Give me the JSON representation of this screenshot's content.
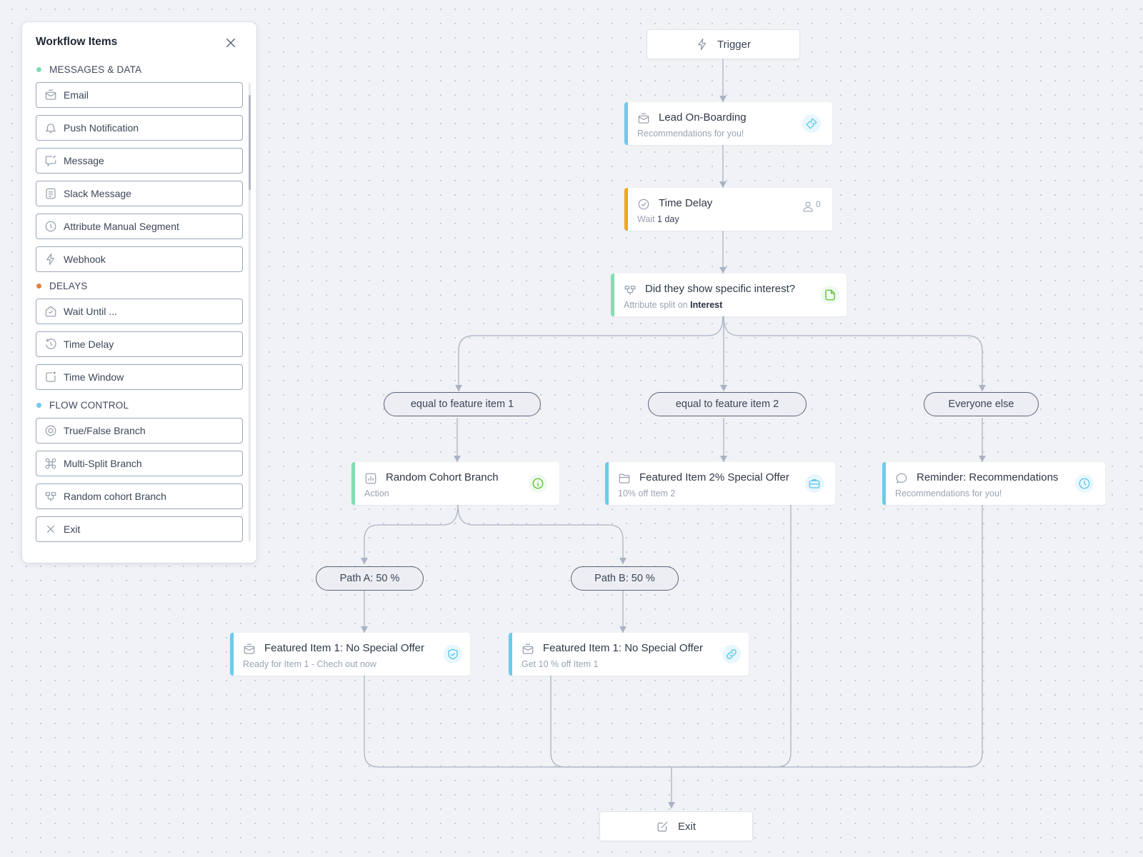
{
  "panel": {
    "title": "Workflow Items",
    "close_icon": "close-icon",
    "sections": [
      {
        "label": "MESSAGES & DATA",
        "dot_color": "#7ee0b0",
        "items": [
          {
            "label": "Email",
            "icon": "envelope-icon"
          },
          {
            "label": "Push Notification",
            "icon": "bell-icon"
          },
          {
            "label": "Message",
            "icon": "chat-bubble-icon"
          },
          {
            "label": "Slack Message",
            "icon": "document-lines-icon"
          },
          {
            "label": "Attribute Manual Segment",
            "icon": "clock-icon"
          },
          {
            "label": "Webhook",
            "icon": "lightning-icon"
          }
        ]
      },
      {
        "label": "DELAYS",
        "dot_color": "#e0803d",
        "items": [
          {
            "label": "Wait Until ...",
            "icon": "open-envelope-check-icon"
          },
          {
            "label": "Time Delay",
            "icon": "history-icon"
          },
          {
            "label": "Time Window",
            "icon": "window-dot-icon"
          }
        ]
      },
      {
        "label": "FLOW CONTROL",
        "dot_color": "#6dcbea",
        "items": [
          {
            "label": "True/False Branch",
            "icon": "target-icon"
          },
          {
            "label": "Multi-Split Branch",
            "icon": "command-icon"
          },
          {
            "label": "Random cohort Branch",
            "icon": "split-branch-icon"
          },
          {
            "label": "Exit",
            "icon": "x-icon"
          }
        ]
      }
    ]
  },
  "flow": {
    "trigger": {
      "label": "Trigger",
      "icon": "lightning-icon"
    },
    "lead_onboarding": {
      "title": "Lead On-Boarding",
      "subtitle": "Recommendations for you!",
      "icon": "envelope-icon",
      "badge_icon": "ticket-icon",
      "accent": "#6dcbea"
    },
    "time_delay": {
      "title": "Time Delay",
      "subtitle_prefix": "Wait",
      "subtitle_value": "1 day",
      "icon": "check-circle-icon",
      "user_count": "0",
      "accent": "#f5a320"
    },
    "interest_split": {
      "title": "Did they show specific interest?",
      "subtitle_prefix": "Attribute split on",
      "subtitle_value": "Interest",
      "icon": "split-branch-icon",
      "badge_icon": "note-icon",
      "accent": "#7ee0b0"
    },
    "branches": [
      {
        "label": "equal to feature item 1"
      },
      {
        "label": "equal to feature item 2"
      },
      {
        "label": "Everyone else"
      }
    ],
    "random_cohort": {
      "title": "Random Cohort Branch",
      "subtitle": "Action",
      "icon": "bar-chart-icon",
      "badge_icon": "info-icon",
      "accent": "#7ee0b0"
    },
    "featured_item2": {
      "title": "Featured Item 2% Special Offer",
      "subtitle": "10% off Item 2",
      "icon": "folder-icon",
      "badge_icon": "briefcase-icon",
      "accent": "#6dcbea"
    },
    "reminder": {
      "title": "Reminder: Recommendations",
      "subtitle": "Recommendations for you!",
      "icon": "speech-bubble-icon",
      "badge_icon": "clock-icon",
      "accent": "#6dcbea"
    },
    "paths": [
      {
        "label": "Path A: 50 %"
      },
      {
        "label": "Path B: 50 %"
      }
    ],
    "featured_a": {
      "title": "Featured Item 1: No Special Offer",
      "subtitle": "Ready for Item 1 - Chech out now",
      "icon": "envelope-icon",
      "badge_icon": "shield-check-icon",
      "accent": "#6dcbea"
    },
    "featured_b": {
      "title": "Featured Item 1: No Special Offer",
      "subtitle": "Get 10 % off Item 1",
      "icon": "envelope-icon",
      "badge_icon": "link-icon",
      "accent": "#6dcbea"
    },
    "exit": {
      "label": "Exit",
      "icon": "edit-square-icon"
    }
  },
  "colors": {
    "green_accent": "#7ee0b0",
    "blue_accent": "#6dcbea",
    "orange_accent": "#f5a320",
    "badge_green": "#5cc02a",
    "badge_blue": "#55c3ea",
    "connector": "#aab3c3"
  }
}
